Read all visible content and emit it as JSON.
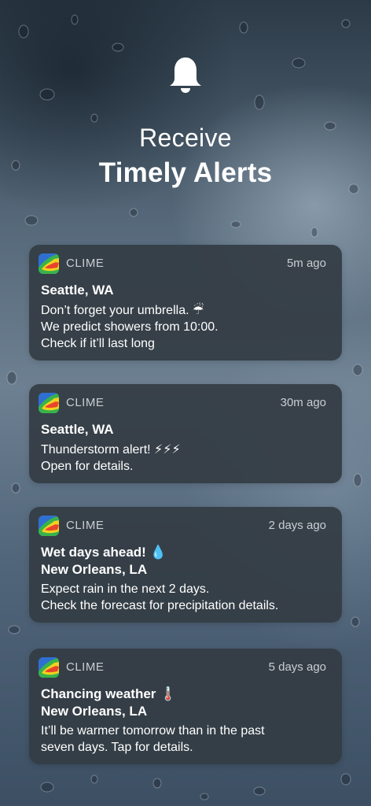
{
  "hero": {
    "line1": "Receive",
    "line2": "Timely Alerts",
    "icon": "bell-icon"
  },
  "colors": {
    "card_bg": "#343c44",
    "secondary_text": "#c9ced3"
  },
  "notifications": [
    {
      "app": "CLIME",
      "time": "5m ago",
      "title": "Seattle, WA",
      "subtitle": "",
      "lines": [
        "Don’t forget your umbrella. ☔",
        "We predict showers from 10:00.",
        "Check if it’ll last long"
      ]
    },
    {
      "app": "CLIME",
      "time": "30m ago",
      "title": "Seattle, WA",
      "subtitle": "",
      "lines": [
        "Thunderstorm alert! ⚡⚡⚡",
        "Open for details."
      ]
    },
    {
      "app": "CLIME",
      "time": "2 days ago",
      "title": "Wet days ahead! 💧",
      "subtitle": "New Orleans, LA",
      "lines": [
        "Expect rain in the next 2 days.",
        "Check the forecast for precipitation details."
      ]
    },
    {
      "app": "CLIME",
      "time": "5 days ago",
      "title": "Chancing weather 🌡️",
      "subtitle": "New Orleans, LA",
      "lines": [
        "It’ll be warmer tomorrow than in the past",
        "seven days. Tap for details."
      ]
    }
  ]
}
